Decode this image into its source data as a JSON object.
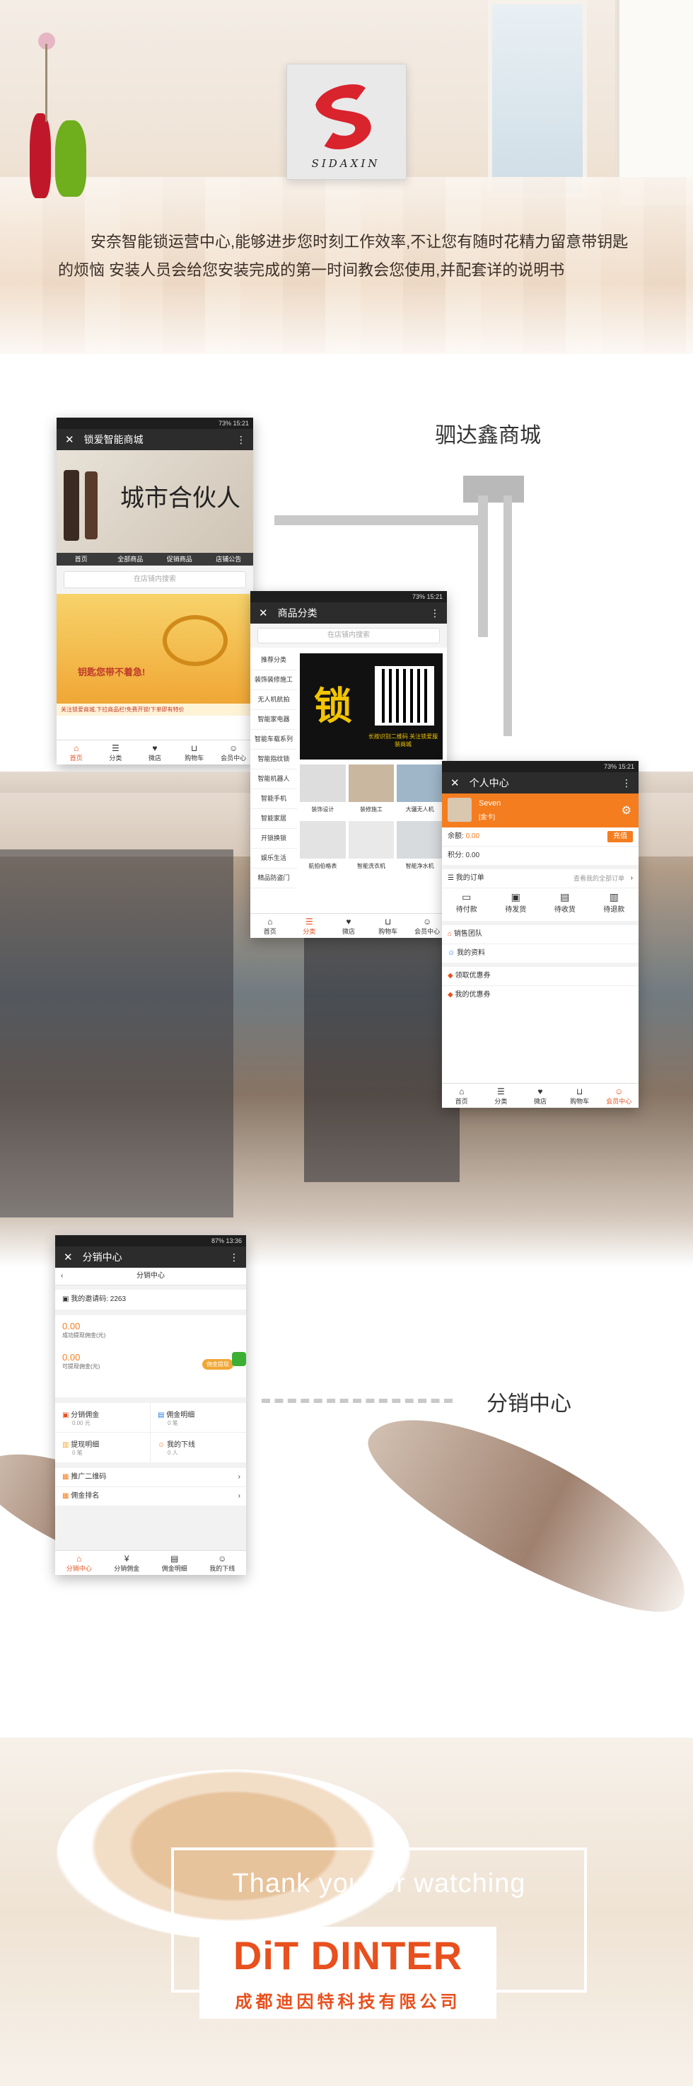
{
  "hero": {
    "logo_text": "SIDAXIN",
    "description": "安奈智能锁运营中心,能够进步您时刻工作效率,不让您有随时花精力留意带钥匙的烦恼 安装人员会给您安装完成的第一时间教会您使用,并配套详的说明书"
  },
  "labels": {
    "mall": "驷达鑫商城",
    "distribution": "分销中心"
  },
  "phone1": {
    "status": "73% 15:21",
    "title": "锁爱智能商城",
    "banner_text": "城市合伙人",
    "nav": [
      "首页",
      "全部商品",
      "促销商品",
      "店铺公告"
    ],
    "search_placeholder": "在店铺内搜索",
    "promo_text": "钥匙您带不着急!",
    "footer_note": "关注锁爱商城,下拉商品栏!免费开锁!下单即有特价",
    "tabs": [
      "首页",
      "分类",
      "微店",
      "购物车",
      "会员中心"
    ]
  },
  "phone2": {
    "status": "73% 15:21",
    "title": "商品分类",
    "search_placeholder": "在店铺内搜索",
    "categories": [
      "推荐分类",
      "装饰装修施工",
      "无人机航拍",
      "智能家电器",
      "智能车载系列",
      "智能指纹锁",
      "智能机器人",
      "智能手机",
      "智能家居",
      "开锁换锁",
      "娱乐生活",
      "精品防盗门"
    ],
    "banner_char": "锁",
    "banner_caption": "长按识别二维码 关注锁爱服装商城",
    "products": [
      "装饰设计",
      "装修施工",
      "大疆无人机",
      "航拍伯格表",
      "智能洗衣机",
      "智能净水机"
    ],
    "tabs": [
      "首页",
      "分类",
      "微店",
      "购物车",
      "会员中心"
    ]
  },
  "phone3": {
    "status": "73% 15:21",
    "title": "个人中心",
    "user_name": "Seven",
    "user_level": "[金卡]",
    "balance_label": "余额:",
    "balance_value": "0.00",
    "recharge": "充值",
    "points": "积分: 0.00",
    "orders_label": "我的订单",
    "orders_link": "查看我的全部订单",
    "order_states": [
      "待付款",
      "待发货",
      "待收货",
      "待退款"
    ],
    "menu": [
      "销售团队",
      "我的资料",
      "领取优惠券",
      "我的优惠券"
    ],
    "tabs": [
      "首页",
      "分类",
      "微店",
      "购物车",
      "会员中心"
    ]
  },
  "phone4": {
    "status": "87% 13:36",
    "title": "分销中心",
    "subtitle": "分销中心",
    "invite": "我的邀请码: 2263",
    "earn1_value": "0.00",
    "earn1_label": "成功提现佣金(元)",
    "earn2_value": "0.00",
    "earn2_label": "可提现佣金(元)",
    "withdraw": "佣金提现",
    "grid": [
      {
        "title": "分销佣金",
        "sub": "0.00 元"
      },
      {
        "title": "佣金明细",
        "sub": "0 笔"
      },
      {
        "title": "提现明细",
        "sub": "0 笔"
      },
      {
        "title": "我的下线",
        "sub": "0 人"
      }
    ],
    "rows": [
      "推广二维码",
      "佣金排名"
    ],
    "tabs": [
      "分销中心",
      "分销佣金",
      "佣金明细",
      "我的下线"
    ]
  },
  "footer": {
    "thanks": "Thank you for watching",
    "brand": "DiT DINTER",
    "company": "成都迪因特科技有限公司"
  },
  "colors": {
    "accent": "#e8501e",
    "logo_red": "#d9232d"
  }
}
